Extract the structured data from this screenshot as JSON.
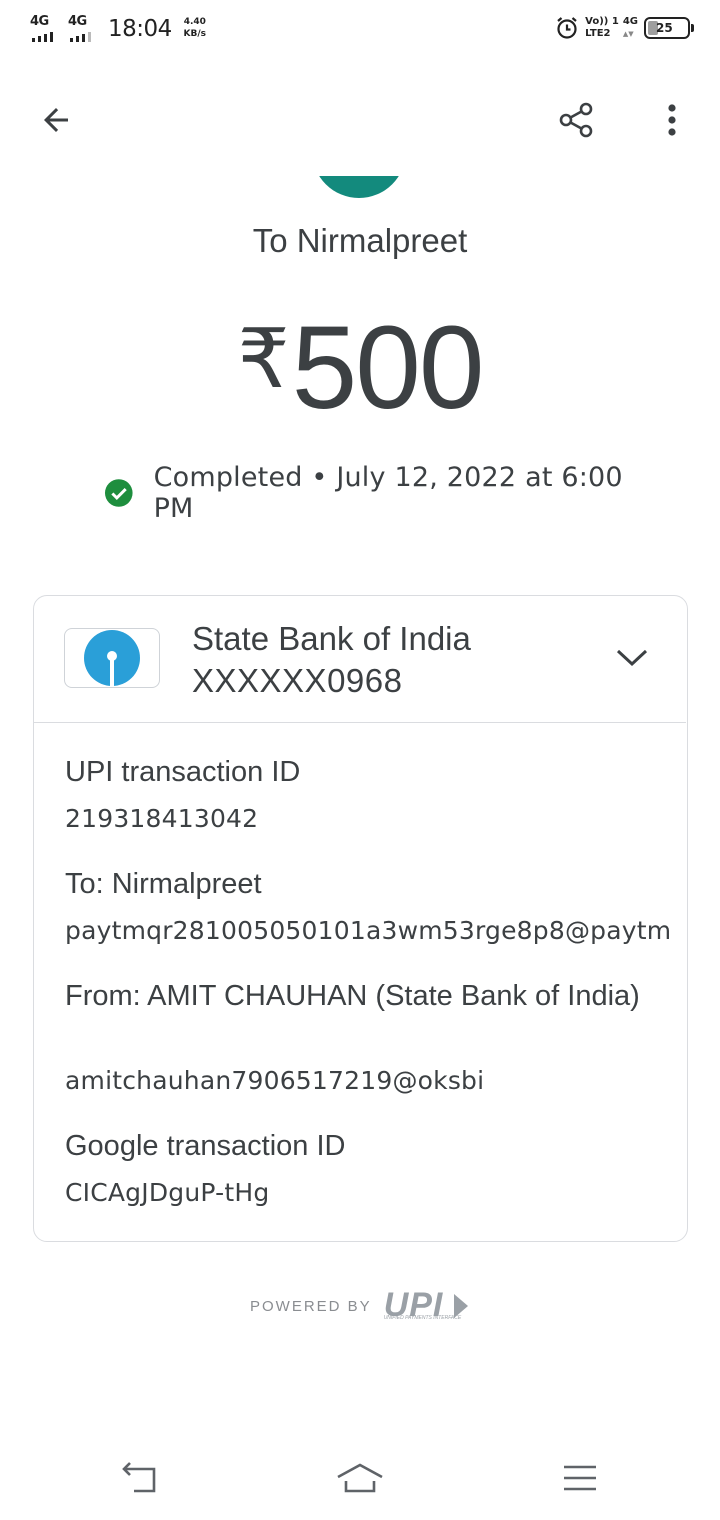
{
  "status_bar": {
    "network_1": "4G",
    "network_2": "4G",
    "time": "18:04",
    "speed_value": "4.40",
    "speed_unit": "KB/s",
    "volte_line1": "Vo)) 1",
    "volte_line2": "LTE2",
    "signal_right": "4G",
    "battery": "25"
  },
  "toolbar": {
    "back_icon": "arrow-left-icon",
    "share_icon": "share-icon",
    "more_icon": "more-vert-icon"
  },
  "payment": {
    "to_title": "To Nirmalpreet",
    "currency": "₹",
    "amount": "500",
    "status_text": "Completed • July 12, 2022 at 6:00 PM",
    "status_color": "#1e8e3e",
    "avatar_color": "#138a7d"
  },
  "account": {
    "bank_name": "State Bank of India",
    "account_number": "XXXXXX0968",
    "logo_color": "#2a9fd8"
  },
  "details": {
    "upi_label": "UPI transaction ID",
    "upi_value": "219318413042",
    "to_label": "To: Nirmalpreet",
    "to_value": "paytmqr281005050101a3wm53rge8p8@paytm",
    "from_label": "From: AMIT  CHAUHAN (State Bank of India)",
    "from_value": "amitchauhan7906517219@oksbi",
    "google_label": "Google transaction ID",
    "google_value": "CICAgJDguP-tHg"
  },
  "footer": {
    "powered_by": "POWERED BY",
    "upi_word": "UPI",
    "upi_sub": "UNIFIED PAYMENTS INTERFACE"
  },
  "nav": {
    "back": "nav-back-icon",
    "home": "nav-home-icon",
    "menu": "nav-menu-icon"
  }
}
